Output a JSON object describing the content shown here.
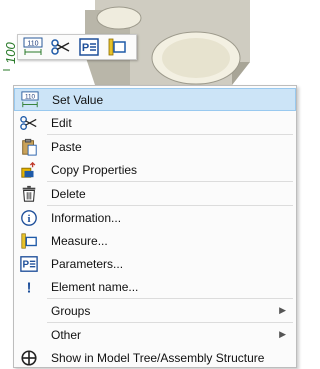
{
  "background": {
    "dimension_label": "100",
    "part_color": "#c9c6bb",
    "dimension_color": "#2a7a2a"
  },
  "mini_toolbar": {
    "buttons": [
      {
        "icon": "dimension-value-icon",
        "text": "110"
      },
      {
        "icon": "scissors-icon"
      },
      {
        "icon": "parameters-icon",
        "text": "P"
      },
      {
        "icon": "measure-icon"
      }
    ]
  },
  "menu": {
    "highlight_color": "#cce4f7",
    "items": [
      {
        "label": "Set Value",
        "icon": "dimension-value-icon",
        "icon_text": "110",
        "active": true
      },
      {
        "label": "Edit",
        "icon": "scissors-icon"
      },
      {
        "label": "Paste",
        "icon": "paste-icon"
      },
      {
        "label": "Copy Properties",
        "icon": "copy-properties-icon"
      },
      {
        "label": "Delete",
        "icon": "trash-icon"
      },
      {
        "label": "Information...",
        "icon": "info-icon",
        "icon_text": "i"
      },
      {
        "label": "Measure...",
        "icon": "measure-icon"
      },
      {
        "label": "Parameters...",
        "icon": "parameters-icon",
        "icon_text": "P"
      },
      {
        "label": "Element name...",
        "icon": "exclamation-icon",
        "icon_text": "!"
      },
      {
        "label": "Groups",
        "has_submenu": true,
        "arrow": "▶"
      },
      {
        "label": "Other",
        "has_submenu": true,
        "arrow": "▶"
      },
      {
        "label": "Show in Model Tree/Assembly Structure",
        "icon": "locate-icon"
      }
    ]
  }
}
